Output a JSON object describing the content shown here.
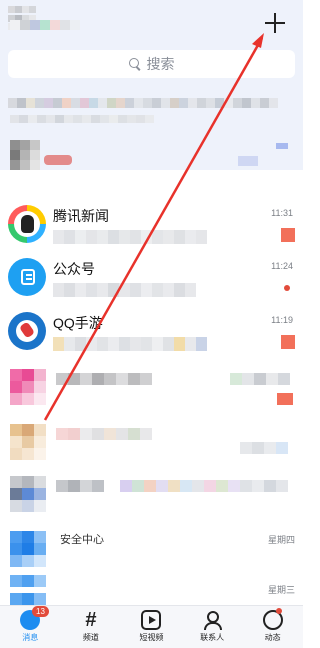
{
  "header": {
    "plus_icon": "plus-icon",
    "search_placeholder": "搜索"
  },
  "chats": [
    {
      "name": "腾讯新闻",
      "time": "11:31",
      "icon": "tencent-news-icon",
      "unread_dot": false
    },
    {
      "name": "公众号",
      "time": "11:24",
      "icon": "public-account-icon",
      "unread_dot": true
    },
    {
      "name": "QQ手游",
      "time": "11:19",
      "icon": "qq-mobile-games-icon",
      "unread_dot": false
    }
  ],
  "blurred_rows": [
    {
      "text": "",
      "time": ""
    },
    {
      "text": "",
      "time": ""
    },
    {
      "text": "",
      "time": ""
    },
    {
      "text": "安全中心",
      "time": "星期四"
    },
    {
      "text": "",
      "time": "星期三"
    }
  ],
  "tabbar": {
    "tabs": [
      {
        "label": "消息",
        "icon": "message-icon",
        "badge": "13"
      },
      {
        "label": "频道",
        "icon": "channel-icon",
        "glyph": "#"
      },
      {
        "label": "短视频",
        "icon": "video-icon"
      },
      {
        "label": "联系人",
        "icon": "contacts-icon"
      },
      {
        "label": "动态",
        "icon": "moments-icon"
      }
    ]
  },
  "colors": {
    "accent": "#1d8cf0",
    "arrow": "#e8322b",
    "badge": "#e24b3b",
    "header_bg": "#eef2fb"
  }
}
